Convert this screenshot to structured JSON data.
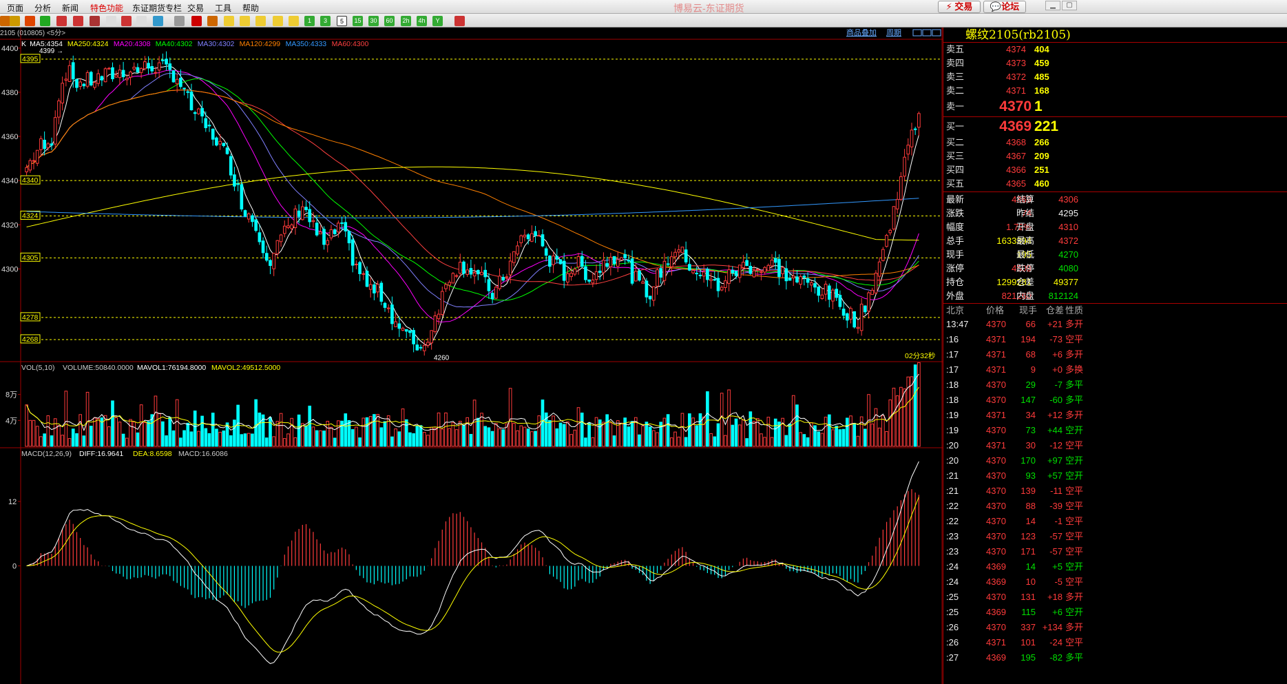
{
  "menu": {
    "items": [
      "页面",
      "分析",
      "新闻",
      "特色功能",
      "东证期货专栏",
      "交易",
      "工具",
      "帮助"
    ],
    "active": "特色功能",
    "title": "博易云-东证期货",
    "trade_btn": "交易",
    "forum_btn": "论坛"
  },
  "toolbar": {
    "period_buttons": [
      "1",
      "3",
      "5",
      "15",
      "30",
      "60",
      "2h",
      "4h",
      "Y"
    ]
  },
  "chart_header": {
    "symbol_line": "2105 (010805) <5分>",
    "links": [
      "商品叠加",
      "周期"
    ],
    "ma_labels": [
      {
        "text": "K",
        "color": "#ffffff"
      },
      {
        "text": "MA5:4354",
        "color": "#ffffff"
      },
      {
        "text": "MA250:4324",
        "color": "#ffff00"
      },
      {
        "text": "MA20:4308",
        "color": "#ff00ff"
      },
      {
        "text": "MA40:4302",
        "color": "#00ff00"
      },
      {
        "text": "MA30:4302",
        "color": "#8080ff"
      },
      {
        "text": "MA120:4299",
        "color": "#ff8000"
      },
      {
        "text": "MA350:4333",
        "color": "#3399ff"
      },
      {
        "text": "MA60:4300",
        "color": "#ff4040"
      }
    ],
    "countdown": "02分32秒",
    "vol_header": [
      {
        "text": "VOL(5,10)",
        "color": "#cccccc"
      },
      {
        "text": "VOLUME:50840.0000",
        "color": "#cccccc"
      },
      {
        "text": "MAVOL1:76194.8000",
        "color": "#ffffff"
      },
      {
        "text": "MAVOL2:49512.5000",
        "color": "#ffff00"
      }
    ],
    "macd_header": [
      {
        "text": "MACD(12,26,9)",
        "color": "#cccccc"
      },
      {
        "text": "DIFF:16.9641",
        "color": "#ffffff"
      },
      {
        "text": "DEA:8.6598",
        "color": "#ffff00"
      },
      {
        "text": "MACD:16.6086",
        "color": "#cccccc"
      }
    ]
  },
  "chart_data": {
    "type": "candlestick",
    "y_axis": {
      "range": [
        4258,
        4404
      ],
      "ticks": [
        4300,
        4320,
        4340,
        4360,
        4380,
        4400
      ]
    },
    "price_levels": [
      4395,
      4340,
      4324,
      4305,
      4278,
      4268
    ],
    "annotations": [
      {
        "text": "4399",
        "value": 4399
      },
      {
        "text": "4260",
        "value": 4260
      }
    ],
    "vol_axis": {
      "range": [
        0,
        120000
      ],
      "labels": [
        "8万",
        "4万"
      ],
      "ticks": [
        80000,
        40000
      ]
    },
    "macd_axis": {
      "range": [
        -22,
        22
      ],
      "ticks": [
        12,
        0
      ]
    },
    "ma_series": [
      {
        "name": "MA5",
        "color": "#ffffff"
      },
      {
        "name": "MA20",
        "color": "#ff00ff"
      },
      {
        "name": "MA30",
        "color": "#8080ff"
      },
      {
        "name": "MA40",
        "color": "#00ff00"
      },
      {
        "name": "MA60",
        "color": "#ff4040"
      },
      {
        "name": "MA120",
        "color": "#ff8000"
      },
      {
        "name": "MA250",
        "color": "#ffff00"
      },
      {
        "name": "MA350",
        "color": "#3399ff"
      }
    ],
    "colors": {
      "up": "#ff3b3b",
      "down": "#00ffff",
      "axis": "#a00000",
      "level": "#ffff00"
    }
  },
  "quote": {
    "title": "螺纹2105(rb2105)",
    "asks": [
      {
        "label": "卖五",
        "price": "4374",
        "vol": "404"
      },
      {
        "label": "卖四",
        "price": "4373",
        "vol": "459"
      },
      {
        "label": "卖三",
        "price": "4372",
        "vol": "485"
      },
      {
        "label": "卖二",
        "price": "4371",
        "vol": "168"
      }
    ],
    "ask1": {
      "label": "卖一",
      "price": "4370",
      "vol": "1"
    },
    "bid1": {
      "label": "买一",
      "price": "4369",
      "vol": "221"
    },
    "bids": [
      {
        "label": "买二",
        "price": "4368",
        "vol": "266"
      },
      {
        "label": "买三",
        "price": "4367",
        "vol": "209"
      },
      {
        "label": "买四",
        "price": "4366",
        "vol": "251"
      },
      {
        "label": "买五",
        "price": "4365",
        "vol": "460"
      }
    ],
    "stats": [
      {
        "l1": "最新",
        "v1": "4369",
        "c1": "red",
        "l2": "结算",
        "v2": "4306",
        "c2": "red"
      },
      {
        "l1": "涨跌",
        "v1": "74",
        "c1": "red",
        "l2": "昨结",
        "v2": "4295",
        "c2": "white"
      },
      {
        "l1": "幅度",
        "v1": "1.72%",
        "c1": "red",
        "l2": "开盘",
        "v2": "4310",
        "c2": "red"
      },
      {
        "l1": "总手",
        "v1": "1633394",
        "c1": "yellow",
        "l2": "最高",
        "v2": "4372",
        "c2": "red"
      },
      {
        "l1": "现手",
        "v1": "195",
        "c1": "yellow",
        "l2": "最低",
        "v2": "4270",
        "c2": "green"
      },
      {
        "l1": "涨停",
        "v1": "4509",
        "c1": "red",
        "l2": "跌停",
        "v2": "4080",
        "c2": "green"
      },
      {
        "l1": "持仓",
        "v1": "1299281",
        "c1": "yellow",
        "l2": "仓差",
        "v2": "49377",
        "c2": "yellow"
      },
      {
        "l1": "外盘",
        "v1": "821260",
        "c1": "red",
        "l2": "内盘",
        "v2": "812124",
        "c2": "green"
      }
    ],
    "ticks_header": [
      "北京",
      "价格",
      "现手",
      "仓差",
      "性质"
    ],
    "ticks": [
      {
        "t": "13:47",
        "p": "4370",
        "v": "66",
        "vc": "red",
        "d": "+21",
        "dc": "red",
        "n": "多开",
        "nc": "red"
      },
      {
        "t": ":16",
        "p": "4371",
        "v": "194",
        "vc": "red",
        "d": "-73",
        "dc": "red",
        "n": "空平",
        "nc": "red"
      },
      {
        "t": ":17",
        "p": "4371",
        "v": "68",
        "vc": "red",
        "d": "+6",
        "dc": "red",
        "n": "多开",
        "nc": "red"
      },
      {
        "t": ":17",
        "p": "4371",
        "v": "9",
        "vc": "red",
        "d": "+0",
        "dc": "red",
        "n": "多换",
        "nc": "red"
      },
      {
        "t": ":18",
        "p": "4370",
        "v": "29",
        "vc": "green",
        "d": "-7",
        "dc": "green",
        "n": "多平",
        "nc": "green"
      },
      {
        "t": ":18",
        "p": "4370",
        "v": "147",
        "vc": "green",
        "d": "-60",
        "dc": "green",
        "n": "多平",
        "nc": "green"
      },
      {
        "t": ":19",
        "p": "4371",
        "v": "34",
        "vc": "red",
        "d": "+12",
        "dc": "red",
        "n": "多开",
        "nc": "red"
      },
      {
        "t": ":19",
        "p": "4370",
        "v": "73",
        "vc": "green",
        "d": "+44",
        "dc": "green",
        "n": "空开",
        "nc": "green"
      },
      {
        "t": ":20",
        "p": "4371",
        "v": "30",
        "vc": "red",
        "d": "-12",
        "dc": "red",
        "n": "空平",
        "nc": "red"
      },
      {
        "t": ":20",
        "p": "4370",
        "v": "170",
        "vc": "green",
        "d": "+97",
        "dc": "green",
        "n": "空开",
        "nc": "green"
      },
      {
        "t": ":21",
        "p": "4370",
        "v": "93",
        "vc": "green",
        "d": "+57",
        "dc": "green",
        "n": "空开",
        "nc": "green"
      },
      {
        "t": ":21",
        "p": "4370",
        "v": "139",
        "vc": "red",
        "d": "-11",
        "dc": "red",
        "n": "空平",
        "nc": "red"
      },
      {
        "t": ":22",
        "p": "4370",
        "v": "88",
        "vc": "red",
        "d": "-39",
        "dc": "red",
        "n": "空平",
        "nc": "red"
      },
      {
        "t": ":22",
        "p": "4370",
        "v": "14",
        "vc": "red",
        "d": "-1",
        "dc": "red",
        "n": "空平",
        "nc": "red"
      },
      {
        "t": ":23",
        "p": "4370",
        "v": "123",
        "vc": "red",
        "d": "-57",
        "dc": "red",
        "n": "空平",
        "nc": "red"
      },
      {
        "t": ":23",
        "p": "4370",
        "v": "171",
        "vc": "red",
        "d": "-57",
        "dc": "red",
        "n": "空平",
        "nc": "red"
      },
      {
        "t": ":24",
        "p": "4369",
        "v": "14",
        "vc": "green",
        "d": "+5",
        "dc": "green",
        "n": "空开",
        "nc": "green"
      },
      {
        "t": ":24",
        "p": "4369",
        "v": "10",
        "vc": "red",
        "d": "-5",
        "dc": "red",
        "n": "空平",
        "nc": "red"
      },
      {
        "t": ":25",
        "p": "4370",
        "v": "131",
        "vc": "red",
        "d": "+18",
        "dc": "red",
        "n": "多开",
        "nc": "red"
      },
      {
        "t": ":25",
        "p": "4369",
        "v": "115",
        "vc": "green",
        "d": "+6",
        "dc": "green",
        "n": "空开",
        "nc": "green"
      },
      {
        "t": ":26",
        "p": "4370",
        "v": "337",
        "vc": "red",
        "d": "+134",
        "dc": "red",
        "n": "多开",
        "nc": "red"
      },
      {
        "t": ":26",
        "p": "4371",
        "v": "101",
        "vc": "red",
        "d": "-24",
        "dc": "red",
        "n": "空平",
        "nc": "red"
      },
      {
        "t": ":27",
        "p": "4369",
        "v": "195",
        "vc": "green",
        "d": "-82",
        "dc": "green",
        "n": "多平",
        "nc": "green"
      }
    ]
  }
}
